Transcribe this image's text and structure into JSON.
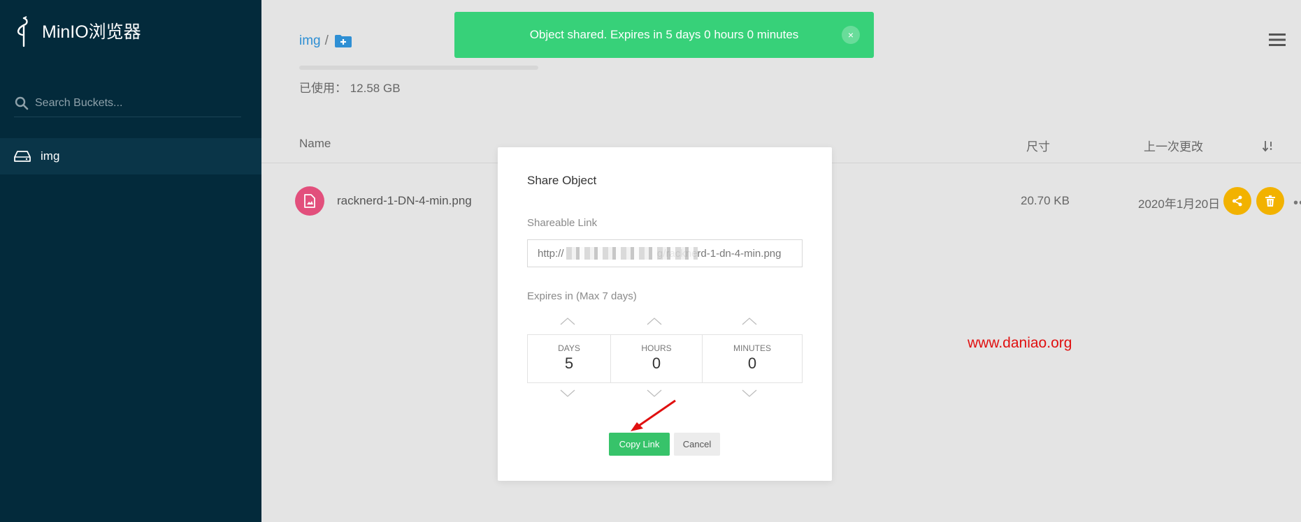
{
  "sidebar": {
    "app_title": "MinIO浏览器",
    "search_placeholder": "Search Buckets...",
    "buckets": [
      {
        "label": "img"
      }
    ]
  },
  "main": {
    "breadcrumb": {
      "bucket": "img",
      "separator": "/"
    },
    "usage": {
      "text": "已使用：  12.58 GB",
      "fill_fraction": 0
    },
    "columns": {
      "name": "Name",
      "size": "尺寸",
      "modified": "上一次更改"
    },
    "files": [
      {
        "name": "racknerd-1-DN-4-min.png",
        "size": "20.70 KB",
        "modified": "2020年1月20日"
      }
    ]
  },
  "toast": {
    "message": "Object shared. Expires in 5 days 0 hours 0 minutes",
    "close_glyph": "×",
    "color": "#37d179"
  },
  "modal": {
    "title": "Share Object",
    "link_label": "Shareable Link",
    "link_value": "http://                                g/racknerd-1-dn-4-min.png",
    "expires_label": "Expires in (Max 7 days)",
    "days_label": "DAYS",
    "days_value": "5",
    "hours_label": "HOURS",
    "hours_value": "0",
    "minutes_label": "MINUTES",
    "minutes_value": "0",
    "copy_button": "Copy Link",
    "cancel_button": "Cancel"
  },
  "watermark": "www.daniao.org",
  "colors": {
    "sidebar": "#032a3b",
    "accent": "#2e8fd4",
    "success": "#37c36a",
    "action": "#f2b200",
    "file_icon": "#e24f7c"
  }
}
